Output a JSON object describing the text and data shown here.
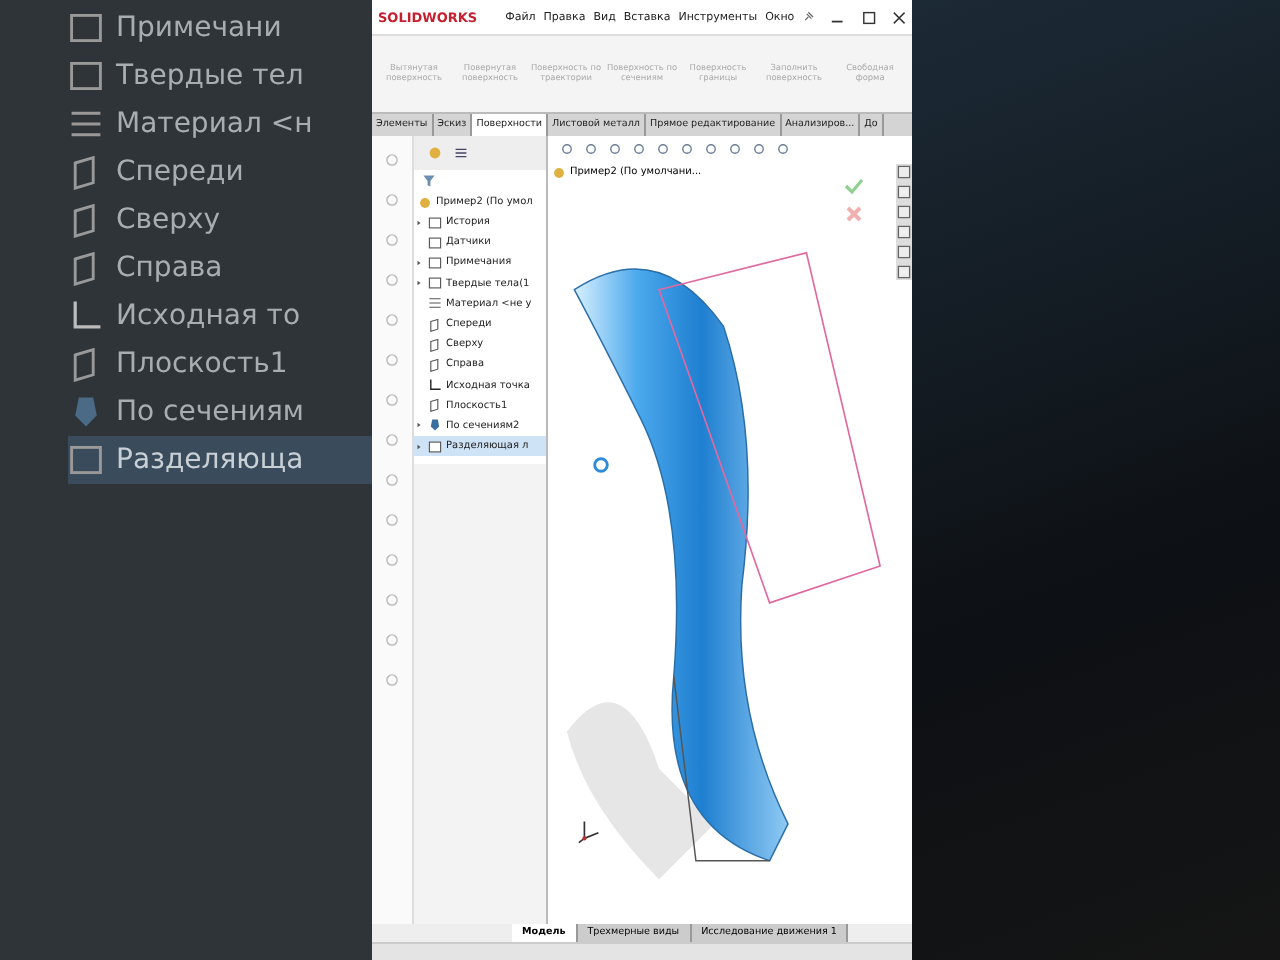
{
  "background_tree": [
    {
      "label": "Примечани",
      "kind": "folder",
      "selected": false
    },
    {
      "label": "Твердые тел",
      "kind": "folder",
      "selected": false
    },
    {
      "label": "Материал <н",
      "kind": "material",
      "selected": false
    },
    {
      "label": "Спереди",
      "kind": "plane",
      "selected": false
    },
    {
      "label": "Сверху",
      "kind": "plane",
      "selected": false
    },
    {
      "label": "Справа",
      "kind": "plane",
      "selected": false
    },
    {
      "label": "Исходная то",
      "kind": "origin",
      "selected": false
    },
    {
      "label": "Плоскость1",
      "kind": "plane",
      "selected": false
    },
    {
      "label": "По сечениям",
      "kind": "loft",
      "selected": false
    },
    {
      "label": "Разделяюща",
      "kind": "folder",
      "selected": true
    }
  ],
  "window": {
    "logo": "SOLIDWORKS",
    "menu": [
      "Файл",
      "Правка",
      "Вид",
      "Вставка",
      "Инструменты",
      "Окно"
    ]
  },
  "toolbar": [
    "Вытянутая поверхность",
    "Повернутая поверхность",
    "Поверхность по траектории",
    "Поверхность по сечениям",
    "Поверхность границы",
    "Заполнить поверхность",
    "Свободная форма"
  ],
  "tabs": [
    {
      "label": "Элементы",
      "selected": false
    },
    {
      "label": "Эскиз",
      "selected": false
    },
    {
      "label": "Поверхности",
      "selected": true
    },
    {
      "label": "Листовой металл",
      "selected": false
    },
    {
      "label": "Прямое редактирование",
      "selected": false
    },
    {
      "label": "Анализиров...",
      "selected": false
    },
    {
      "label": "До",
      "selected": false
    }
  ],
  "tree": {
    "root": "Пример2 (По умол",
    "items": [
      {
        "label": "История",
        "kind": "folder",
        "expanded": false,
        "selected": false
      },
      {
        "label": "Датчики",
        "kind": "folder",
        "selected": false
      },
      {
        "label": "Примечания",
        "kind": "folder",
        "expanded": false,
        "selected": false
      },
      {
        "label": "Твердые тела(1",
        "kind": "folder",
        "expanded": false,
        "selected": false
      },
      {
        "label": "Материал <не у",
        "kind": "material",
        "selected": false
      },
      {
        "label": "Спереди",
        "kind": "plane",
        "selected": false
      },
      {
        "label": "Сверху",
        "kind": "plane",
        "selected": false
      },
      {
        "label": "Справа",
        "kind": "plane",
        "selected": false
      },
      {
        "label": "Исходная точка",
        "kind": "origin",
        "selected": false
      },
      {
        "label": "Плоскость1",
        "kind": "plane",
        "selected": false
      },
      {
        "label": "По сечениям2",
        "kind": "loft",
        "expanded": false,
        "selected": false
      },
      {
        "label": "Разделяющая л",
        "kind": "folder",
        "expanded": false,
        "selected": true
      }
    ]
  },
  "viewport": {
    "breadcrumb": "Пример2 (По умолчани..."
  },
  "bottom_tabs": [
    {
      "label": "Модель",
      "selected": true
    },
    {
      "label": "Трехмерные виды",
      "selected": false
    },
    {
      "label": "Исследование движения 1",
      "selected": false
    }
  ]
}
